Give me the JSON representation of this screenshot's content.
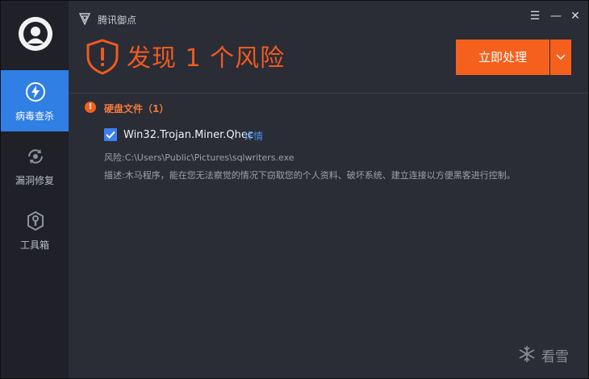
{
  "app": {
    "title": "腾讯御点"
  },
  "sidebar": {
    "items": [
      {
        "label": "病毒查杀",
        "icon": "lightning-icon",
        "active": true
      },
      {
        "label": "漏洞修复",
        "icon": "repair-cycle-icon",
        "active": false
      },
      {
        "label": "工具箱",
        "icon": "wrench-icon",
        "active": false
      }
    ]
  },
  "window_controls": {
    "menu": "☰",
    "minimize": "—",
    "close": "✕"
  },
  "alert": {
    "title": "发现 1 个风险"
  },
  "actions": {
    "primary_label": "立即处理",
    "dropdown_icon": "chevron-down-icon"
  },
  "section": {
    "title": "硬盘文件（1）",
    "icon_glyph": "!"
  },
  "threat": {
    "checked": true,
    "name": "Win32.Trojan.Miner.Qhec",
    "detail_link": "详情",
    "risk_line": "风险:C:\\Users\\Public\\Pictures\\sqlwriters.exe",
    "desc_line": "描述:木马程序，能在您无法察觉的情况下窃取您的个人资料、破坏系统、建立连接以方便黑客进行控制。"
  },
  "watermark": {
    "text": "看雪"
  },
  "colors": {
    "accent": "#f5601d",
    "active_nav": "#2f7fe4",
    "link": "#4b8fe9",
    "panel": "#2a2c36",
    "sidebar": "#1f2028"
  }
}
